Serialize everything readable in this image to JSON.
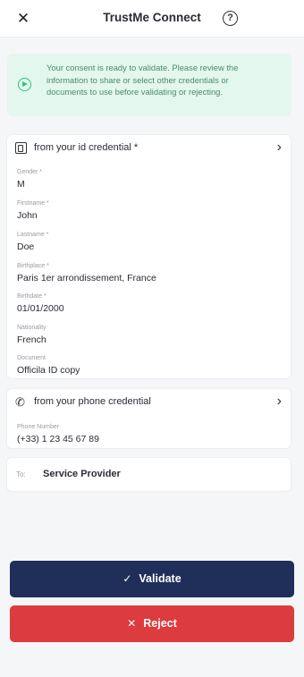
{
  "header": {
    "title": "TrustMe Connect",
    "close_glyph": "✕",
    "help_glyph": "?"
  },
  "notice": {
    "text": "Your consent is ready to validate. Please review the information to share or select other credentials or documents to use before validating or rejecting.",
    "icon": "play-circle-icon",
    "color": "#2ec27e",
    "background": "#e3f7ee"
  },
  "id_credential": {
    "title": "from your id credential *",
    "icon": "id-card-icon",
    "fields": [
      {
        "label": "Gender *",
        "value": "M"
      },
      {
        "label": "Firstname *",
        "value": "John"
      },
      {
        "label": "Lastname *",
        "value": "Doe"
      },
      {
        "label": "Birthplace *",
        "value": "Paris 1er arrondissement, France"
      },
      {
        "label": "Birthdate *",
        "value": "01/01/2000"
      },
      {
        "label": "Nationality",
        "value": "French"
      },
      {
        "label": "Document",
        "value": "Officila ID copy"
      }
    ]
  },
  "phone_credential": {
    "title": "from your phone  credential",
    "icon": "phone-icon",
    "glyph": "✆",
    "fields": [
      {
        "label": "Phone Number",
        "value": "(+33) 1 23 45 67 89"
      }
    ]
  },
  "recipient": {
    "label": "To:",
    "value": "Service Provider"
  },
  "actions": {
    "validate_label": "Validate",
    "validate_glyph": "✓",
    "reject_label": "Reject",
    "reject_glyph": "✕",
    "validate_color": "#1f2f59",
    "reject_color": "#dc3b3f"
  }
}
